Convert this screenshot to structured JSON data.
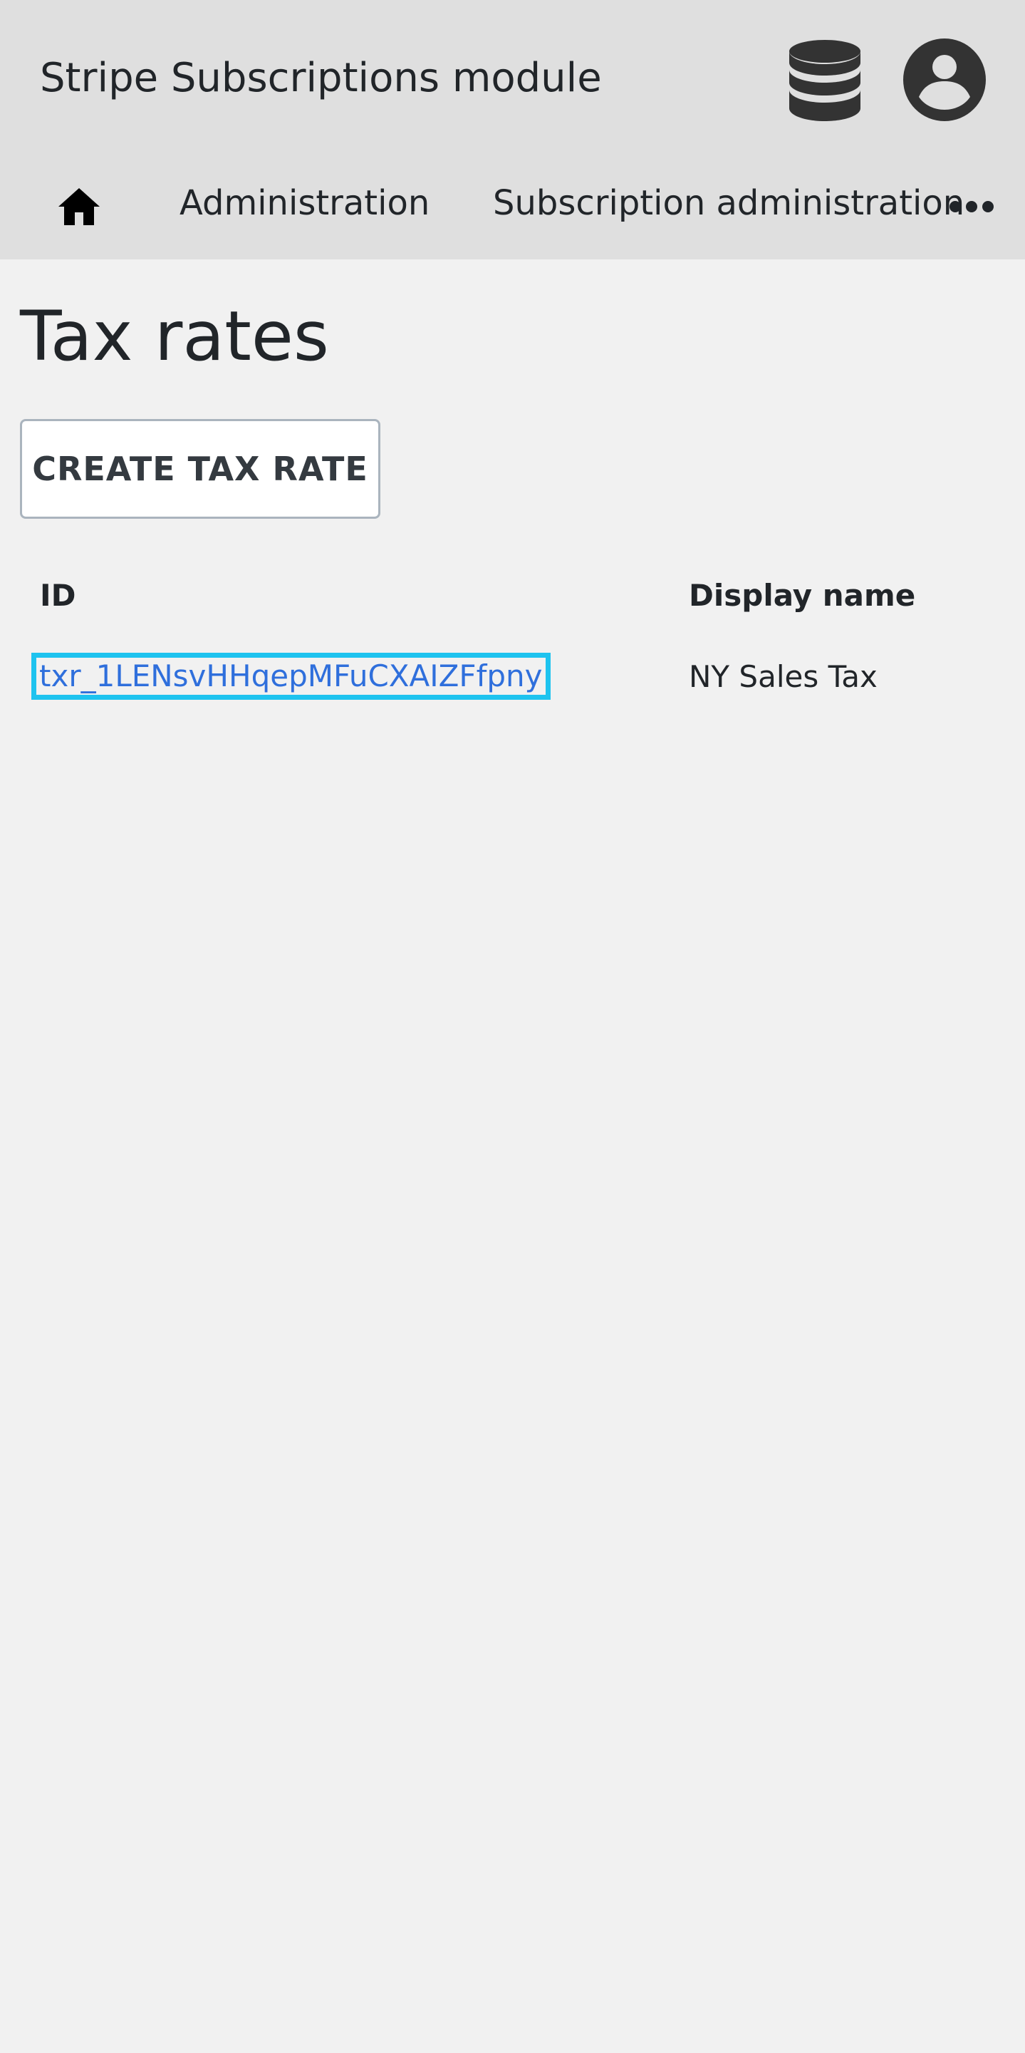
{
  "header": {
    "app_title": "Stripe Subscriptions module",
    "icons": [
      "database-icon",
      "user-account-icon"
    ]
  },
  "nav": {
    "home_icon": "home-icon",
    "items": [
      {
        "label": "Administration"
      },
      {
        "label": "Subscription administration"
      }
    ],
    "more_icon": "more-icon"
  },
  "page": {
    "title": "Tax rates",
    "create_button_label": "CREATE TAX RATE"
  },
  "table": {
    "columns": [
      "ID",
      "Display name"
    ],
    "rows": [
      {
        "id": "txr_1LENsvHHqepMFuCXAIZFfpny",
        "display_name": "NY Sales Tax"
      }
    ]
  },
  "colors": {
    "header_bg": "#dfdfdf",
    "page_bg": "#f1f1f1",
    "link": "#2f6fdc",
    "focus_outline": "#1ec3ef"
  }
}
